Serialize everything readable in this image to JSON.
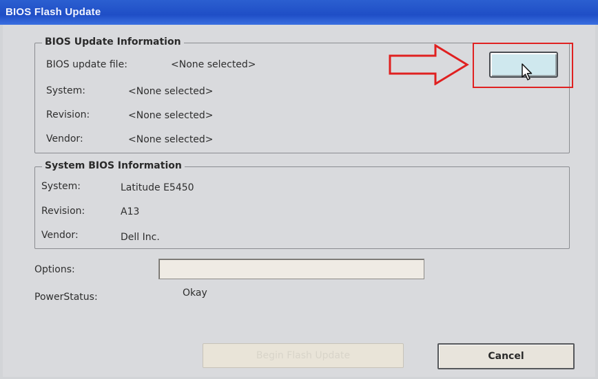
{
  "window": {
    "title": "BIOS Flash Update"
  },
  "update_info": {
    "legend": "BIOS Update Information",
    "file_label": "BIOS update file:",
    "file_value": "<None selected>",
    "system_label": "System:",
    "system_value": "<None selected>",
    "revision_label": "Revision:",
    "revision_value": "<None selected>",
    "vendor_label": "Vendor:",
    "vendor_value": "<None selected>"
  },
  "system_info": {
    "legend": "System BIOS Information",
    "system_label": "System:",
    "system_value": "Latitude E5450",
    "revision_label": "Revision:",
    "revision_value": "A13",
    "vendor_label": "Vendor:",
    "vendor_value": "Dell Inc."
  },
  "options": {
    "label": "Options:",
    "value": ""
  },
  "power": {
    "label": "PowerStatus:",
    "value": "Okay"
  },
  "buttons": {
    "begin": "Begin Flash Update",
    "cancel": "Cancel"
  },
  "colors": {
    "titlebar": "#1f4ec6",
    "annotation": "#e02020"
  },
  "icons": [
    "mouse-cursor-icon",
    "red-arrow-annotation"
  ]
}
